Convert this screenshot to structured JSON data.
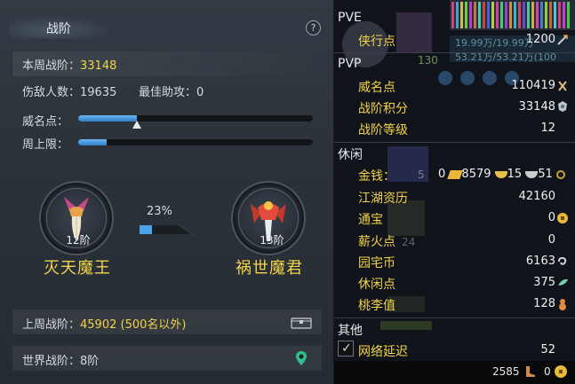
{
  "left_panel": {
    "title": "战阶",
    "help": "?",
    "weekly_rank": {
      "label": "本周战阶：",
      "value": "33148"
    },
    "kills": {
      "label": "伤敌人数：",
      "value": "19635"
    },
    "best_assist": {
      "label": "最佳助攻：",
      "value": "0"
    },
    "prestige": {
      "label": "威名点：",
      "progress": 0.25
    },
    "weekly_cap": {
      "label": "周上限：",
      "progress": 0.12
    },
    "current_rank": {
      "level": "12阶",
      "name": "灭天魔王"
    },
    "next_rank": {
      "level": "13阶",
      "name": "祸世魔君"
    },
    "rank_progress": "23%",
    "rank_progress_value": 0.23,
    "last_week": {
      "label": "上周战阶：",
      "value": "45902 (500名以外)"
    },
    "world_rank": {
      "label": "世界战阶：",
      "value": "8阶"
    }
  },
  "right_panel": {
    "pve": {
      "title": "PVE",
      "rows": [
        {
          "label": "侠行点",
          "value": "1200"
        }
      ]
    },
    "pvp": {
      "title": "PVP",
      "rows": [
        {
          "label": "威名点",
          "value": "110419"
        },
        {
          "label": "战阶积分",
          "value": "33148"
        },
        {
          "label": "战阶等级",
          "value": "12"
        }
      ]
    },
    "leisure": {
      "title": "休闲",
      "money": {
        "label": "金钱：",
        "v0": "0",
        "v1": "8579",
        "v2": "15",
        "v3": "51"
      },
      "rows": [
        {
          "label": "江湖资历",
          "value": "42160"
        },
        {
          "label": "通宝",
          "value": "0"
        },
        {
          "label": "薪火点",
          "value": "0"
        },
        {
          "label": "园宅币",
          "value": "6163"
        },
        {
          "label": "休闲点",
          "value": "375"
        },
        {
          "label": "桃李值",
          "value": "128"
        }
      ]
    },
    "other": {
      "title": "其他",
      "rows": [
        {
          "label": "网络延迟",
          "value": "52",
          "checked": true
        }
      ]
    },
    "footer": {
      "left_value": "2585",
      "right_value": "0"
    },
    "background_texts": [
      "19.99万/19.99万",
      "53.21万/53.21万(100",
      "130",
      "5",
      "24"
    ]
  },
  "colors": {
    "accent_yellow": "#f2d34a",
    "bar_blue": "#3f8fd6"
  }
}
